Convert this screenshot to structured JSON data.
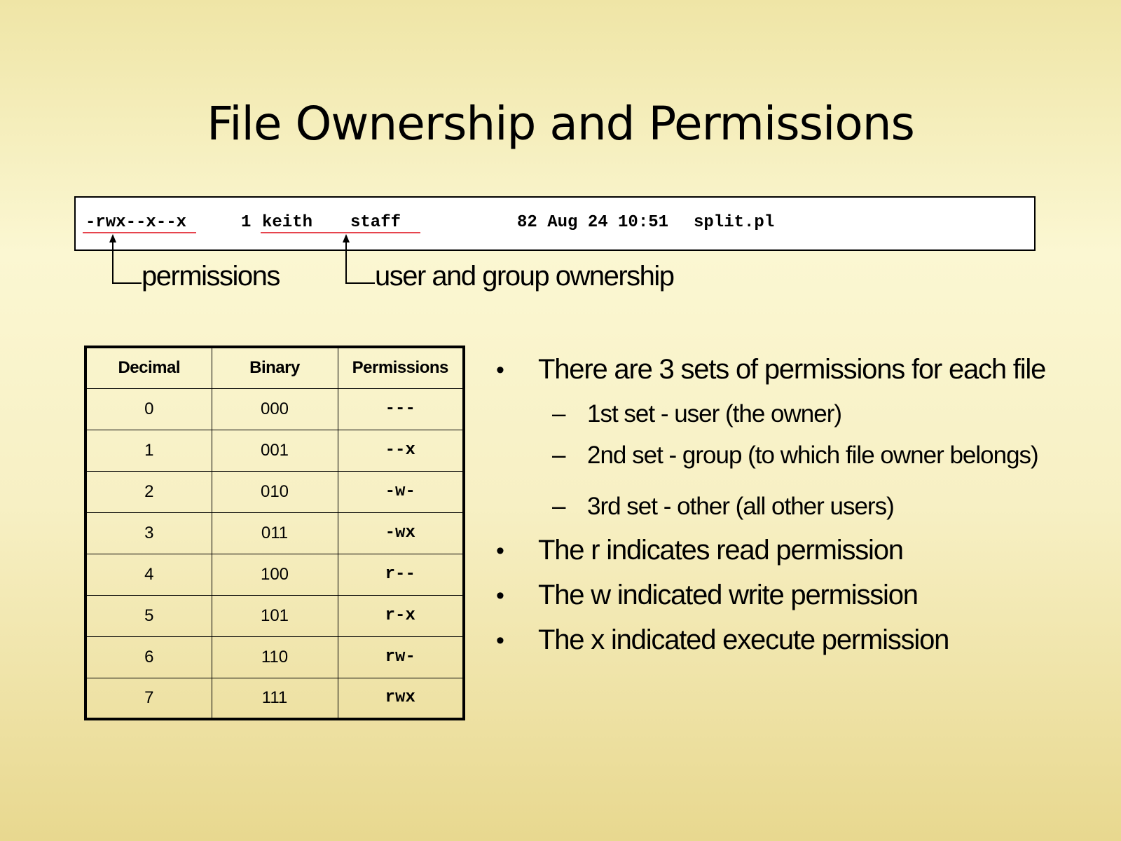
{
  "slide": {
    "title": "File Ownership and Permissions"
  },
  "ls_line": {
    "permissions": "-rwx--x--x",
    "links": "1",
    "user": "keith",
    "group": "staff",
    "size_date": "82 Aug 24 10:51",
    "filename": "split.pl"
  },
  "callouts": {
    "permissions_label": "permissions",
    "ownership_label": "user and group ownership"
  },
  "perm_table": {
    "headers": [
      "Decimal",
      "Binary",
      "Permissions"
    ],
    "rows": [
      [
        "0",
        "000",
        "---"
      ],
      [
        "1",
        "001",
        "--x"
      ],
      [
        "2",
        "010",
        "-w-"
      ],
      [
        "3",
        "011",
        "-wx"
      ],
      [
        "4",
        "100",
        "r--"
      ],
      [
        "5",
        "101",
        "r-x"
      ],
      [
        "6",
        "110",
        "rw-"
      ],
      [
        "7",
        "111",
        "rwx"
      ]
    ]
  },
  "bullets": {
    "b1": "There are 3 sets of permissions for each file",
    "b1_sub": [
      "1st set - user (the owner)",
      "2nd set - group (to which file owner belongs)",
      "3rd set - other (all other users)"
    ],
    "b2": "The r indicates read permission",
    "b3": "The w indicated write permission",
    "b4": "The x indicated execute permission",
    "bullet_mark": "•",
    "sub_mark": "–"
  }
}
